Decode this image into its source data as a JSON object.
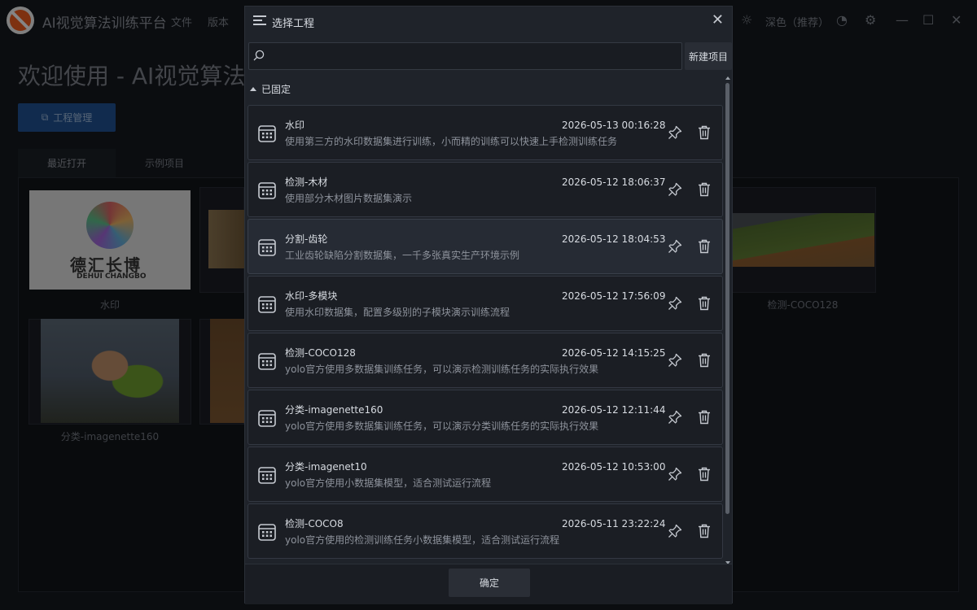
{
  "app": {
    "title": "AI视觉算法训练平台",
    "menu": [
      "文件",
      "版本"
    ],
    "theme_label": "深色（推荐）",
    "welcome_text": "欢迎使用 - AI视觉算法训练平台",
    "project_button": "工程管理",
    "tabs": [
      "最近打开",
      "示例项目"
    ],
    "thumb_labels": [
      "水印",
      "检测-COCO128",
      "分类-imagenette160"
    ],
    "logo_text_cn": "德汇长博",
    "logo_text_en": "DEHUI CHANGBO"
  },
  "dialog": {
    "title": "选择工程",
    "search": {
      "value": "",
      "placeholder": ""
    },
    "new_button": "新建项目",
    "section_label": "已固定",
    "ok_button": "确定",
    "projects": [
      {
        "name": "水印",
        "desc": "使用第三方的水印数据集进行训练，小而精的训练可以快速上手检测训练任务",
        "date": "2026-05-13 00:16:28"
      },
      {
        "name": "检测-木材",
        "desc": "使用部分木材图片数据集演示",
        "date": "2026-05-12 18:06:37"
      },
      {
        "name": "分割-齿轮",
        "desc": "工业齿轮缺陷分割数据集，一千多张真实生产环境示例",
        "date": "2026-05-12 18:04:53"
      },
      {
        "name": "水印-多模块",
        "desc": "使用水印数据集，配置多级别的子模块演示训练流程",
        "date": "2026-05-12 17:56:09"
      },
      {
        "name": "检测-COCO128",
        "desc": "yolo官方使用多数据集训练任务，可以演示检测训练任务的实际执行效果",
        "date": "2026-05-12 14:15:25"
      },
      {
        "name": "分类-imagenette160",
        "desc": "yolo官方使用多数据集训练任务，可以演示分类训练任务的实际执行效果",
        "date": "2026-05-12 12:11:44"
      },
      {
        "name": "分类-imagenet10",
        "desc": "yolo官方使用小数据集模型，适合测试运行流程",
        "date": "2026-05-12 10:53:00"
      },
      {
        "name": "检测-COCO8",
        "desc": "yolo官方使用的检测训练任务小数据集模型，适合测试运行流程",
        "date": "2026-05-11 23:22:24"
      }
    ]
  },
  "colors": {
    "accent": "#1f4f8f",
    "dialog_bg": "#1f232a",
    "row_hover": "#262b34"
  }
}
